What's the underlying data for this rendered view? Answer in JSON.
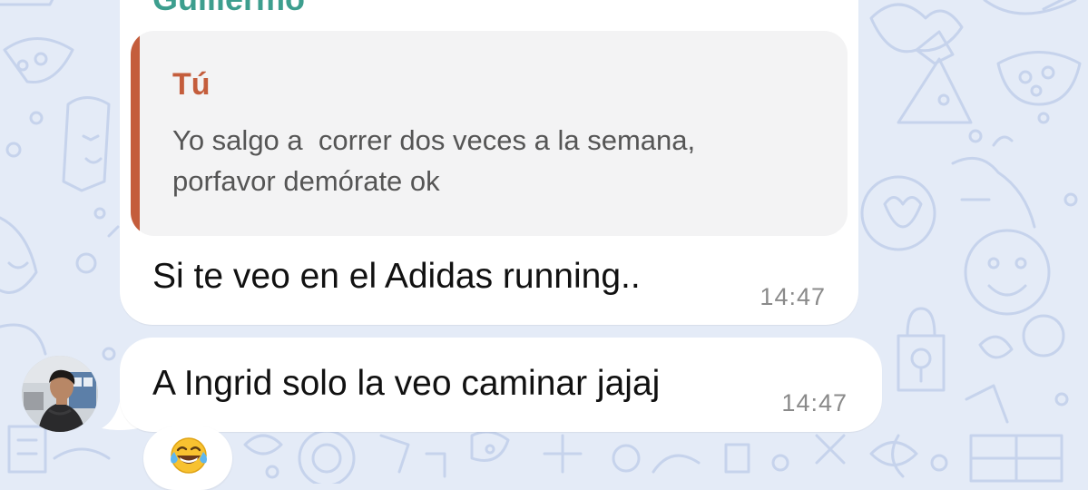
{
  "chat": {
    "messages": [
      {
        "sender": "Guillermo",
        "quote": {
          "author": "Tú",
          "text": "Yo salgo a  correr dos veces a la semana,\nporfavor demórate ok"
        },
        "text": "Si te veo en el Adidas running..",
        "time": "14:47"
      },
      {
        "text": "A Ingrid solo la veo caminar jajaj",
        "time": "14:47",
        "reaction": {
          "icon": "face-with-tears-of-joy-icon"
        }
      }
    ]
  },
  "colors": {
    "wallpaper": "#e4ebf7",
    "doodle": "#c6d3ec",
    "sender_name": "#3d9e8e",
    "quote_accent": "#c45d3c",
    "quote_background": "#f3f3f4",
    "bubble": "#ffffff",
    "timestamp": "#8a8a8a"
  }
}
